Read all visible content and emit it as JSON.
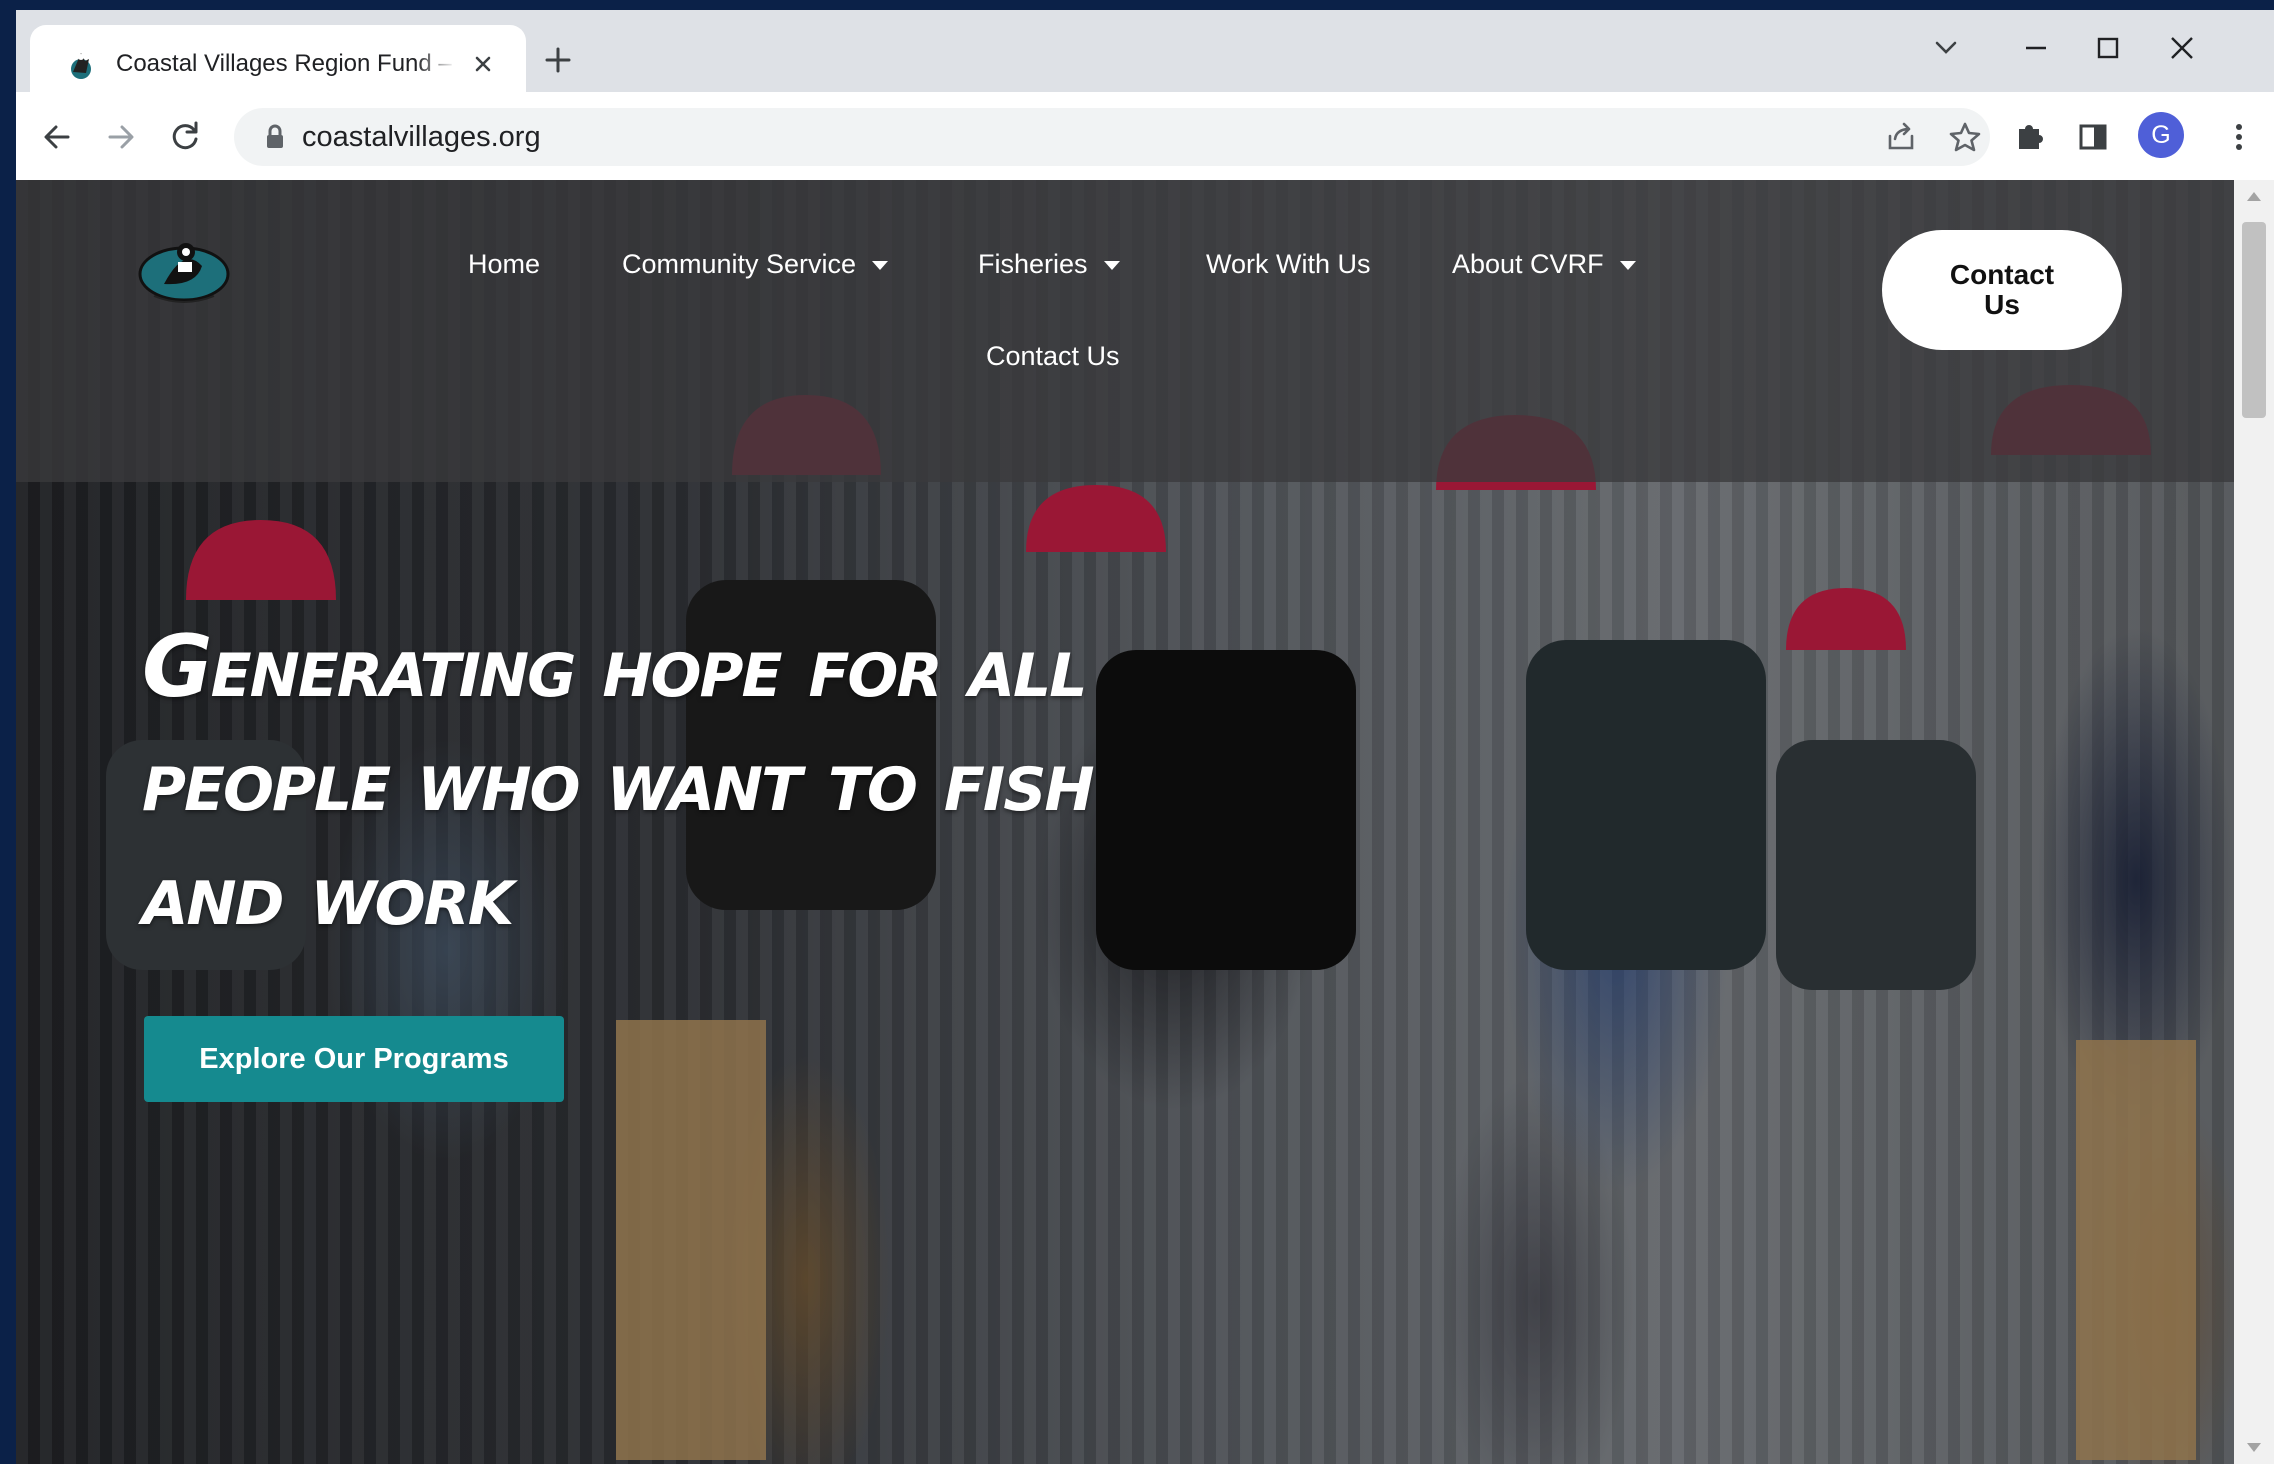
{
  "browser": {
    "tab_title": "Coastal Villages Region Fund – C",
    "url": "coastalvillages.org",
    "profile_initial": "G"
  },
  "site": {
    "nav": {
      "home": "Home",
      "community_service": "Community Service",
      "fisheries": "Fisheries",
      "work_with_us": "Work With Us",
      "about": "About CVRF",
      "contact": "Contact Us"
    },
    "contact_button": "Contact Us",
    "hero": {
      "headline": "Generating hope for all people who want to fish and work",
      "cta_label": "Explore Our Programs"
    }
  },
  "colors": {
    "accent_teal": "#158a8f",
    "helmet_red": "#d6214a",
    "header_band": "#3a3a3c"
  },
  "icons": [
    "favicon-icon",
    "close-icon",
    "plus-icon",
    "chevron-down-icon",
    "minimize-icon",
    "maximize-icon",
    "back-icon",
    "forward-icon",
    "reload-icon",
    "lock-icon",
    "share-icon",
    "star-icon",
    "puzzle-icon",
    "side-panel-icon",
    "more-icon"
  ]
}
